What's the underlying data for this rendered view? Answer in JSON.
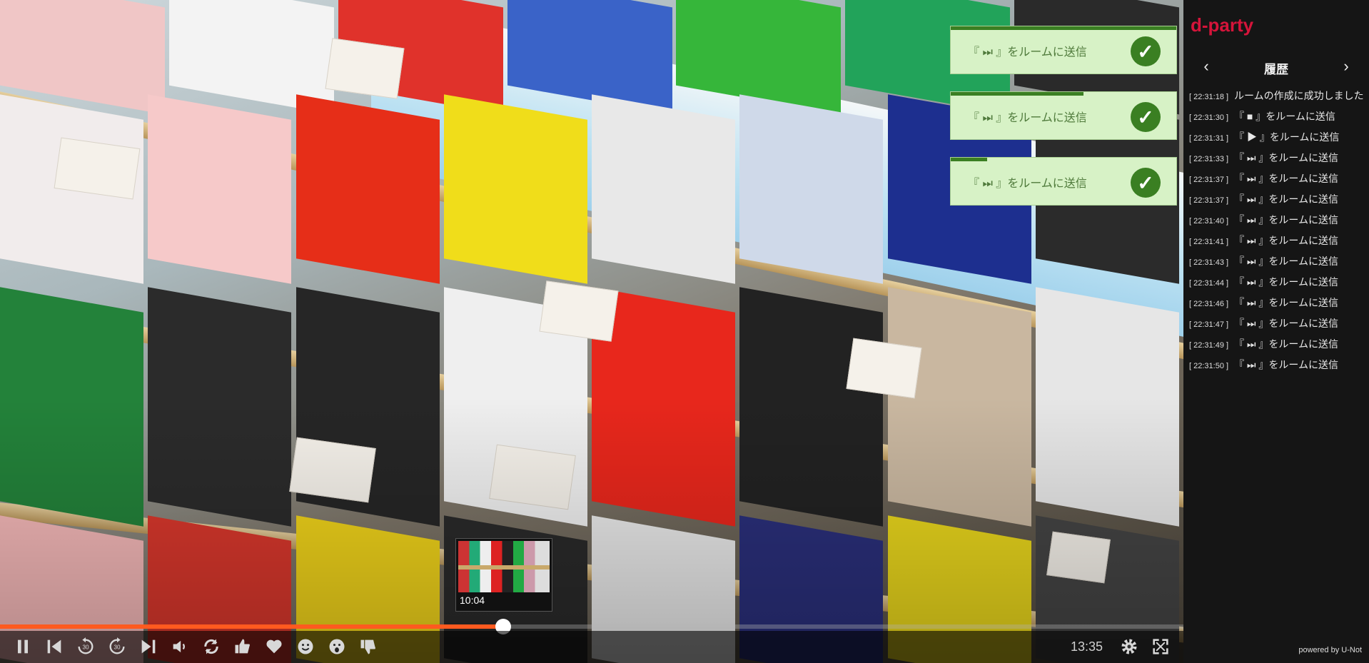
{
  "toasts": [
    {
      "message": "『 ⏭ 』をルームに送信",
      "progress_pct": 100
    },
    {
      "message": "『 ⏭ 』をルームに送信",
      "progress_pct": 59
    },
    {
      "message": "『 ⏭ 』をルームに送信",
      "progress_pct": 16
    }
  ],
  "preview": {
    "time": "10:04"
  },
  "player": {
    "progress_pct": 42.5,
    "duration": "13:35",
    "icons": [
      "pause-icon",
      "skip-back-icon",
      "rewind-30-icon",
      "forward-30-icon",
      "skip-forward-icon",
      "volume-icon",
      "loop-icon",
      "thumbs-up-icon",
      "heart-icon",
      "smile-icon",
      "scream-icon",
      "thumbs-down-icon",
      "settings-icon",
      "fullscreen-icon"
    ]
  },
  "sidebar": {
    "brand": "d-party",
    "history_title": "履歴",
    "entries": [
      {
        "time": "[ 22:31:18 ]",
        "text": "ルームの作成に成功しました"
      },
      {
        "time": "[ 22:31:30 ]",
        "text": "『 ■ 』をルームに送信"
      },
      {
        "time": "[ 22:31:31 ]",
        "text": "『 ▶ 』をルームに送信"
      },
      {
        "time": "[ 22:31:33 ]",
        "text": "『 ⏭ 』をルームに送信"
      },
      {
        "time": "[ 22:31:37 ]",
        "text": "『 ⏭ 』をルームに送信"
      },
      {
        "time": "[ 22:31:37 ]",
        "text": "『 ⏭ 』をルームに送信"
      },
      {
        "time": "[ 22:31:40 ]",
        "text": "『 ⏭ 』をルームに送信"
      },
      {
        "time": "[ 22:31:41 ]",
        "text": "『 ⏭ 』をルームに送信"
      },
      {
        "time": "[ 22:31:43 ]",
        "text": "『 ⏭ 』をルームに送信"
      },
      {
        "time": "[ 22:31:44 ]",
        "text": "『 ⏭ 』をルームに送信"
      },
      {
        "time": "[ 22:31:46 ]",
        "text": "『 ⏭ 』をルームに送信"
      },
      {
        "time": "[ 22:31:47 ]",
        "text": "『 ⏭ 』をルームに送信"
      },
      {
        "time": "[ 22:31:49 ]",
        "text": "『 ⏭ 』をルームに送信"
      },
      {
        "time": "[ 22:31:50 ]",
        "text": "『 ⏭ 』をルームに送信"
      }
    ],
    "powered_by": "powered by U-Not"
  },
  "colors": {
    "accent": "#ff5a1f",
    "brand": "#d5143a",
    "toast_bg": "#d7f2c6",
    "toast_check": "#3a7f22"
  }
}
